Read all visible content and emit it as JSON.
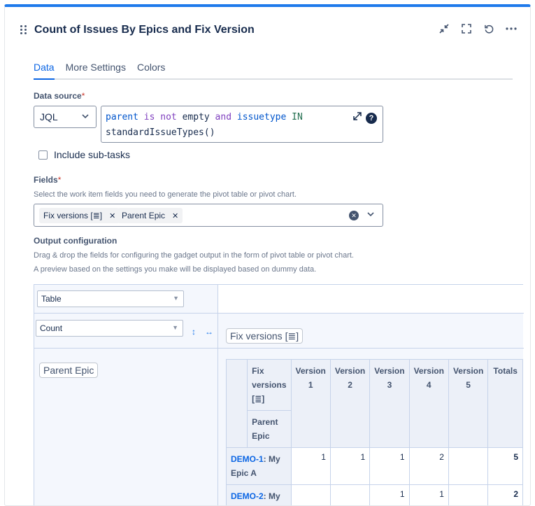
{
  "gadget": {
    "title": "Count of Issues By Epics and Fix Version",
    "icons": [
      "collapse-icon",
      "fullscreen-icon",
      "refresh-icon",
      "more-icon"
    ]
  },
  "tabs": [
    "Data",
    "More Settings",
    "Colors"
  ],
  "data_source": {
    "label": "Data source",
    "required_mark": "*",
    "type": "JQL",
    "query_line1_tokens": [
      "parent",
      " is",
      " not",
      " empty",
      " and",
      " issuetype",
      " IN"
    ],
    "query_line2": "standardIssueTypes()",
    "help_icon": "?"
  },
  "include_subtasks": {
    "label": "Include sub-tasks",
    "checked": false
  },
  "fields": {
    "label": "Fields",
    "required_mark": "*",
    "helper": "Select the work item fields you need to generate the pivot table or pivot chart.",
    "chips": [
      "Fix versions [≣]",
      "Parent Epic"
    ]
  },
  "output": {
    "label": "Output configuration",
    "helper1": "Drag & drop the fields for configuring the gadget output in the form of pivot table or pivot chart.",
    "helper2": "A preview based on the settings you make will be displayed based on dummy data.",
    "renderer": "Table",
    "aggregator": "Count",
    "col_field": "Fix versions [≣]",
    "row_field": "Parent Epic"
  },
  "pivot": {
    "col_header_field": "Fix versions [≣]",
    "row_header_field": "Parent Epic",
    "columns": [
      "Version 1",
      "Version 2",
      "Version 3",
      "Version 4",
      "Version 5",
      "Totals"
    ],
    "rows": [
      {
        "key": "DEMO-1",
        "name": ": My Epic A",
        "values": [
          "1",
          "1",
          "1",
          "2",
          "",
          "5"
        ]
      },
      {
        "key": "DEMO-2",
        "name": ": My Epic B",
        "values": [
          "",
          "",
          "1",
          "1",
          "",
          "2"
        ]
      }
    ]
  }
}
